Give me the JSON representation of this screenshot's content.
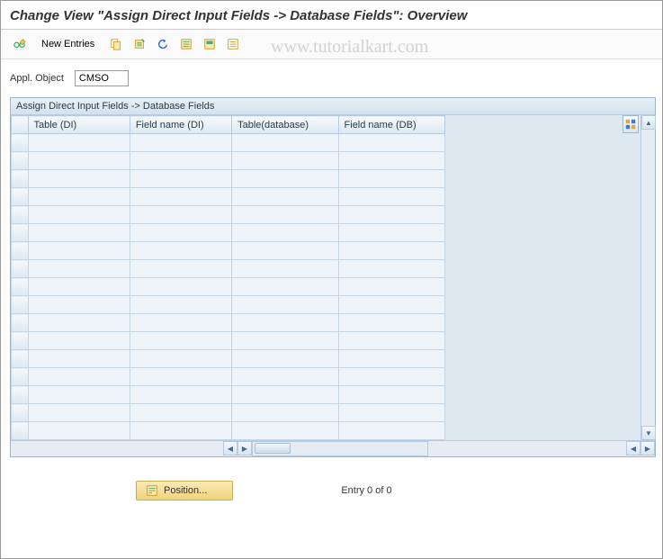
{
  "title": "Change View \"Assign Direct Input Fields -> Database Fields\": Overview",
  "watermark": "www.tutorialkart.com",
  "toolbar": {
    "new_entries_label": "New Entries"
  },
  "form": {
    "appl_object_label": "Appl. Object",
    "appl_object_value": "CMSO"
  },
  "table": {
    "caption": "Assign Direct Input Fields -> Database Fields",
    "columns": [
      "Table (DI)",
      "Field name (DI)",
      "Table(database)",
      "Field name (DB)"
    ],
    "row_count_visible": 17
  },
  "footer": {
    "position_label": "Position...",
    "entry_text": "Entry 0 of 0"
  },
  "icons": {
    "glasses_pencil": "display-change-icon",
    "copy": "copy-icon",
    "save_row": "delete-icon",
    "undo": "undo-icon",
    "select_all": "select-all-icon",
    "select_block": "select-block-icon",
    "deselect": "deselect-icon",
    "config": "table-settings-icon"
  }
}
